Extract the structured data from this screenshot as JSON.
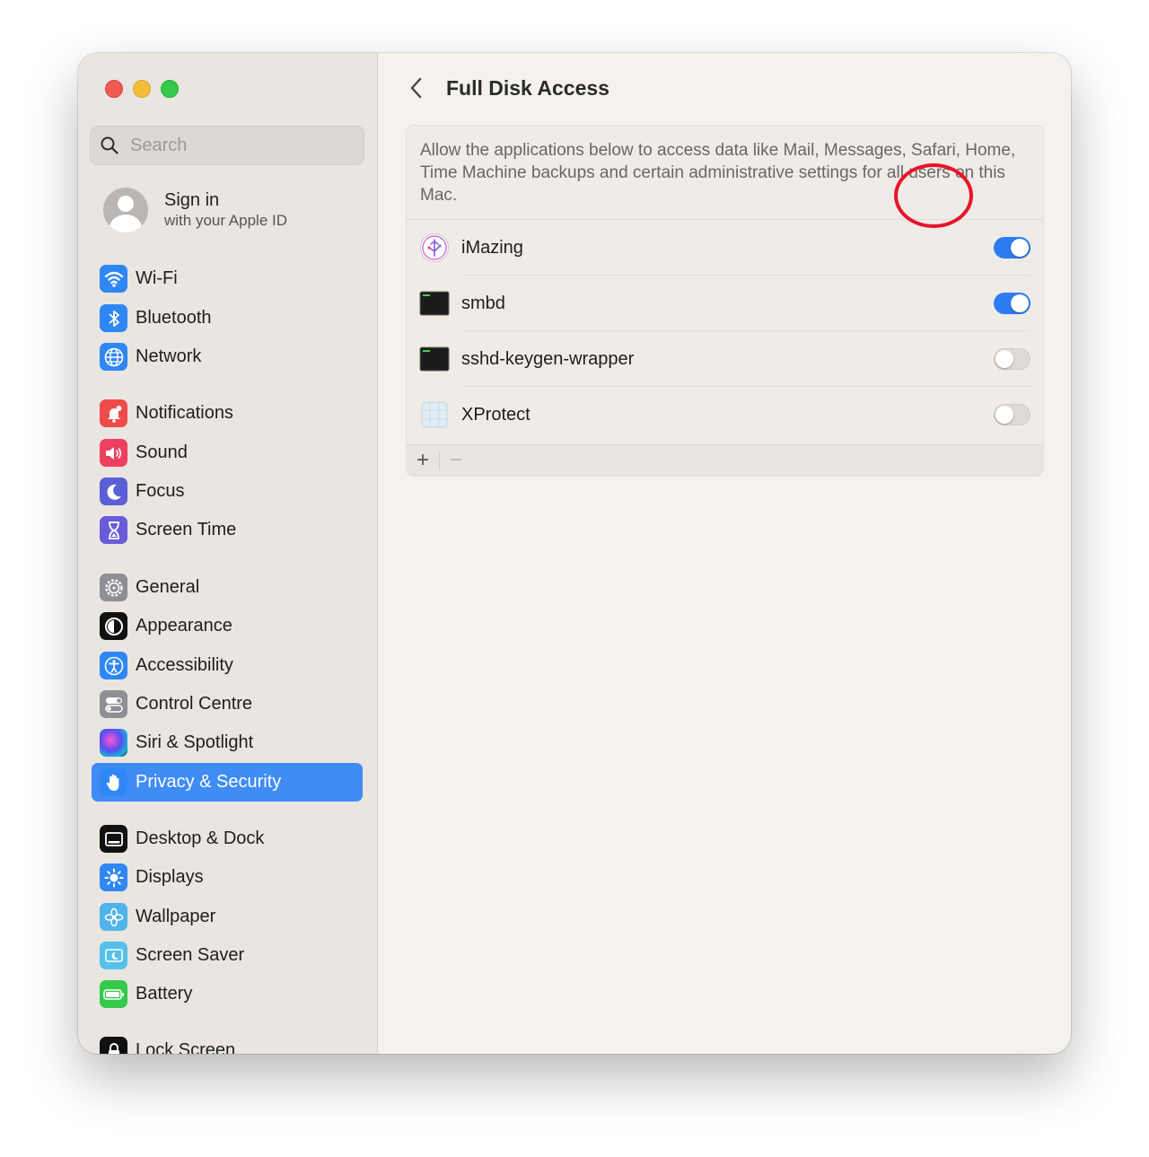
{
  "window": {
    "traffic_lights": [
      "close",
      "minimize",
      "zoom"
    ]
  },
  "sidebar": {
    "search_placeholder": "Search",
    "account": {
      "title": "Sign in",
      "subtitle": "with your Apple ID"
    },
    "items": [
      {
        "label": "Wi-Fi",
        "icon": "wifi-icon",
        "color": "#2f87f5"
      },
      {
        "label": "Bluetooth",
        "icon": "bluetooth-icon",
        "color": "#2f87f5"
      },
      {
        "label": "Network",
        "icon": "globe-icon",
        "color": "#2f87f5"
      },
      {
        "label": "Notifications",
        "icon": "bell-icon",
        "color": "#ef4b4b"
      },
      {
        "label": "Sound",
        "icon": "speaker-icon",
        "color": "#ef3f5e"
      },
      {
        "label": "Focus",
        "icon": "moon-icon",
        "color": "#5b5fd6"
      },
      {
        "label": "Screen Time",
        "icon": "hourglass-icon",
        "color": "#6a5bd8"
      },
      {
        "label": "General",
        "icon": "gear-icon",
        "color": "#8e8e93"
      },
      {
        "label": "Appearance",
        "icon": "appearance-icon",
        "color": "#111111"
      },
      {
        "label": "Accessibility",
        "icon": "accessibility-icon",
        "color": "#2f87f5"
      },
      {
        "label": "Control Centre",
        "icon": "switches-icon",
        "color": "#8e8e93"
      },
      {
        "label": "Siri & Spotlight",
        "icon": "siri-icon",
        "color": "#3b3b8a"
      },
      {
        "label": "Privacy & Security",
        "icon": "hand-icon",
        "color": "#2f87f5",
        "active": true
      },
      {
        "label": "Desktop & Dock",
        "icon": "dock-icon",
        "color": "#111111"
      },
      {
        "label": "Displays",
        "icon": "sun-icon",
        "color": "#2f87f5"
      },
      {
        "label": "Wallpaper",
        "icon": "flower-icon",
        "color": "#4fb4ea"
      },
      {
        "label": "Screen Saver",
        "icon": "screensaver-icon",
        "color": "#55c0ea"
      },
      {
        "label": "Battery",
        "icon": "battery-icon",
        "color": "#35c94a"
      },
      {
        "label": "Lock Screen",
        "icon": "lock-icon",
        "color": "#111111"
      }
    ]
  },
  "main": {
    "title": "Full Disk Access",
    "description": "Allow the applications below to access data like Mail, Messages, Safari, Home, Time Machine backups and certain administrative settings for all users on this Mac.",
    "apps": [
      {
        "name": "iMazing",
        "icon": "imazing-icon",
        "enabled": true
      },
      {
        "name": "smbd",
        "icon": "terminal-icon",
        "enabled": true
      },
      {
        "name": "sshd-keygen-wrapper",
        "icon": "terminal-icon",
        "enabled": false
      },
      {
        "name": "XProtect",
        "icon": "xprotect-icon",
        "enabled": false
      }
    ],
    "footer": {
      "add_label": "+",
      "remove_label": "−"
    },
    "accent_color": "#2d7bf0",
    "annotation_color": "#e8132b"
  }
}
